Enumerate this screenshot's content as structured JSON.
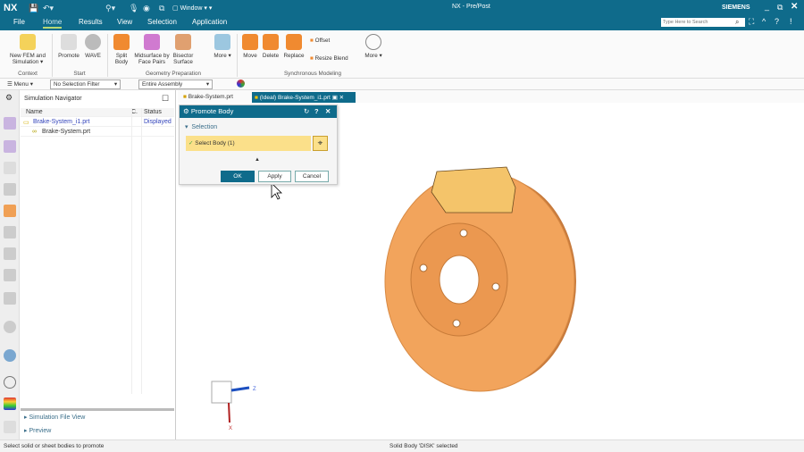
{
  "app": {
    "logo": "NX",
    "title": "NX - Pre/Post",
    "brand": "SIEMENS",
    "window_menu": "Window",
    "search_placeholder": "Type Here to Search"
  },
  "tabs": [
    "File",
    "Home",
    "Results",
    "View",
    "Selection",
    "Application"
  ],
  "ribbon": {
    "groups": [
      {
        "label": "Context",
        "buttons": [
          "New FEM and Simulation"
        ]
      },
      {
        "label": "Start",
        "buttons": [
          "Promote",
          "WAVE"
        ]
      },
      {
        "label": "Geometry Preparation",
        "buttons": [
          "Split Body",
          "Midsurface by Face Pairs",
          "Bisector Surface",
          "More"
        ]
      },
      {
        "label": "Synchronous Modeling",
        "buttons": [
          "Move",
          "Delete",
          "Replace",
          "Offset",
          "Resize Blend",
          "More"
        ]
      }
    ]
  },
  "toolbar": {
    "menu": "Menu",
    "selection_filter": "No Selection Filter",
    "scope": "Entire Assembly"
  },
  "navigator": {
    "title": "Simulation Navigator",
    "columns": [
      "Name",
      "C.",
      "Status"
    ],
    "rows": [
      {
        "name": "Brake-System_i1.prt",
        "status": "Displayed"
      },
      {
        "name": "Brake-System.prt",
        "status": ""
      }
    ],
    "panels": [
      "Simulation File View",
      "Preview"
    ]
  },
  "doc_tabs": [
    "Brake-System.prt",
    "(Ideal) Brake-System_i1.prt"
  ],
  "dialog": {
    "title": "Promote Body",
    "section": "Selection",
    "select_label": "Select Body (1)",
    "ok": "OK",
    "apply": "Apply",
    "cancel": "Cancel"
  },
  "triad": {
    "z": "Z",
    "x": "X"
  },
  "status": {
    "left": "Select solid or sheet bodies to promote",
    "right": "Solid Body 'DISK' selected"
  },
  "colors": {
    "titlebar": "#0f6b8b",
    "disc": "#f0a055",
    "selection_yellow": "#fbe08a"
  }
}
